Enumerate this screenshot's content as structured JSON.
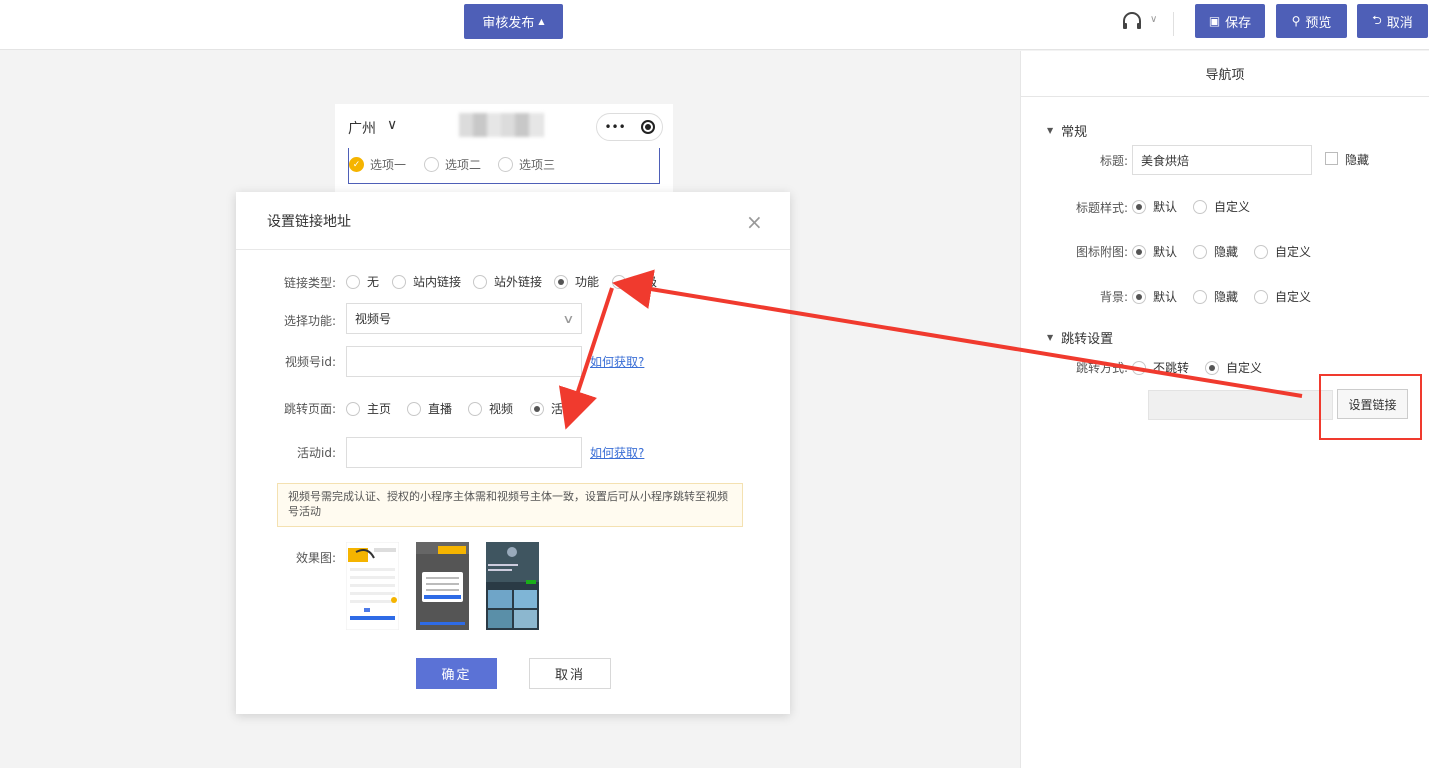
{
  "toolbar": {
    "publish_label": "审核发布",
    "save_label": "保存",
    "preview_label": "预览",
    "cancel_label": "取消",
    "accent": "#4e5fb7"
  },
  "phone_preview": {
    "city": "广州",
    "city_caret": "∨",
    "capsule_more": "•••",
    "options": [
      {
        "label": "选项一",
        "selected": true
      },
      {
        "label": "选项二",
        "selected": false
      },
      {
        "label": "选项三",
        "selected": false
      }
    ]
  },
  "right_panel": {
    "title": "导航项",
    "general_section": "常规",
    "title_label": "标题:",
    "title_value": "美食烘焙",
    "hide_label": "隐藏",
    "title_style_label": "标题样式:",
    "title_style_options": [
      "默认",
      "自定义"
    ],
    "icon_label": "图标附图:",
    "icon_options": [
      "默认",
      "隐藏",
      "自定义"
    ],
    "bg_label": "背景:",
    "bg_options": [
      "默认",
      "隐藏",
      "自定义"
    ],
    "jump_section": "跳转设置",
    "jump_mode_label": "跳转方式:",
    "jump_mode_options": [
      "不跳转",
      "自定义"
    ],
    "set_link_label": "设置链接"
  },
  "modal": {
    "title": "设置链接地址",
    "close_icon": "×",
    "link_type_label": "链接类型:",
    "link_types": [
      "无",
      "站内链接",
      "站外链接",
      "功能",
      "高级"
    ],
    "select_func_label": "选择功能:",
    "select_func_value": "视频号",
    "channel_id_label": "视频号id:",
    "how_to_get": "如何获取?",
    "jump_page_label": "跳转页面:",
    "jump_pages": [
      "主页",
      "直播",
      "视频",
      "活动"
    ],
    "activity_id_label": "活动id:",
    "notice": "视频号需完成认证、授权的小程序主体需和视频号主体一致，设置后可从小程序跳转至视频号活动",
    "effect_label": "效果图:",
    "ok_label": "确定",
    "cancel_label": "取消"
  },
  "colors": {
    "annotation_red": "#f03a2e",
    "primary_button": "#5b72d6",
    "link": "#3b6fd6"
  }
}
